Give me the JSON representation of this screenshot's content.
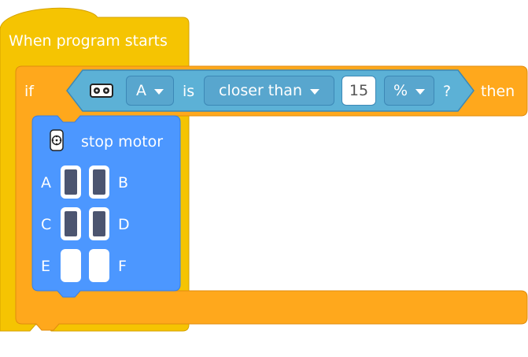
{
  "hat_block": {
    "label": "When program starts"
  },
  "if_block": {
    "if_label": "if",
    "then_label": "then",
    "condition": {
      "sensor_icon": "distance-sensor-icon",
      "port_value": "A",
      "is_label": "is",
      "comparison": "closer than",
      "number": "15",
      "unit": "%",
      "question": "?"
    }
  },
  "stop_block": {
    "icon": "motor-icon",
    "label": "stop motor",
    "ports": [
      {
        "label": "A",
        "selected": true
      },
      {
        "label": "B",
        "selected": true
      },
      {
        "label": "C",
        "selected": true
      },
      {
        "label": "D",
        "selected": true
      },
      {
        "label": "E",
        "selected": false
      },
      {
        "label": "F",
        "selected": false
      }
    ]
  },
  "colors": {
    "events_yellow": "#f5c402",
    "control_orange": "#ffa81c",
    "sensor_blue": "#5cb1d6",
    "motor_blue": "#4c97ff"
  }
}
